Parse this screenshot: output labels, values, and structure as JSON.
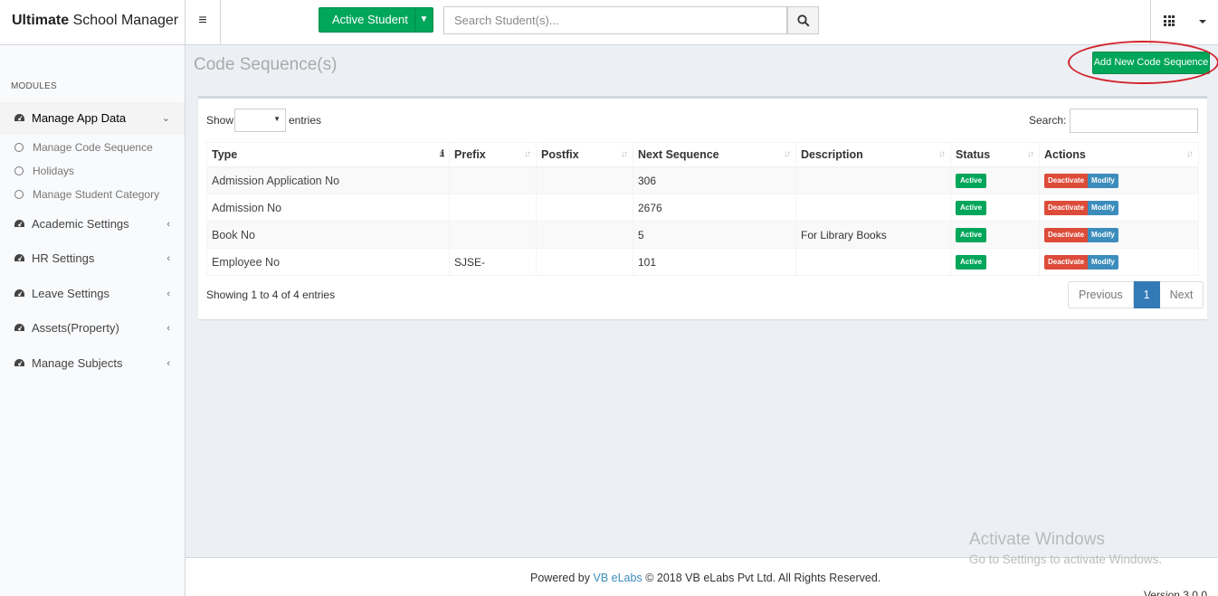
{
  "app": {
    "title_bold": "Ultimate",
    "title_rest": " School Manager"
  },
  "header": {
    "active_student_label": "Active Student",
    "search_placeholder": "Search Student(s)..."
  },
  "sidebar": {
    "modules_label": "MODULES",
    "items": [
      {
        "label": "Manage App Data",
        "expanded": true
      },
      {
        "label": "Academic Settings"
      },
      {
        "label": "HR Settings"
      },
      {
        "label": "Leave Settings"
      },
      {
        "label": "Assets(Property)"
      },
      {
        "label": "Manage Subjects"
      }
    ],
    "subitems": [
      {
        "label": "Manage Code Sequence"
      },
      {
        "label": "Holidays"
      },
      {
        "label": "Manage Student Category"
      }
    ]
  },
  "page": {
    "title": "Code Sequence(s)",
    "add_button": "Add New Code Sequence"
  },
  "table": {
    "show_label": "Show",
    "entries_label": "entries",
    "search_label": "Search:",
    "columns": [
      "Type",
      "Prefix",
      "Postfix",
      "Next Sequence",
      "Description",
      "Status",
      "Actions"
    ],
    "rows": [
      {
        "type": "Admission Application No",
        "prefix": "",
        "postfix": "",
        "next": "306",
        "description": "",
        "status": "Active"
      },
      {
        "type": "Admission No",
        "prefix": "",
        "postfix": "",
        "next": "2676",
        "description": "",
        "status": "Active"
      },
      {
        "type": "Book No",
        "prefix": "",
        "postfix": "",
        "next": "5",
        "description": "For Library Books",
        "status": "Active"
      },
      {
        "type": "Employee No",
        "prefix": "SJSE-",
        "postfix": "",
        "next": "101",
        "description": "",
        "status": "Active"
      }
    ],
    "deactivate_label": "Deactivate",
    "modify_label": "Modify",
    "showing_text": "Showing 1 to 4 of 4 entries",
    "pagination": {
      "previous": "Previous",
      "current": "1",
      "next": "Next"
    }
  },
  "footer": {
    "powered_by": "Powered by",
    "link": "VB eLabs",
    "copyright": "© 2018 VB eLabs Pvt Ltd. All Rights Reserved.",
    "version": "Version 3.0.0"
  },
  "watermark": {
    "line1": "Activate Windows",
    "line2": "Go to Settings to activate Windows."
  },
  "colors": {
    "green": "#00a65a",
    "red": "#dd4b39",
    "blue": "#3c8dbc",
    "annotation": "#d2232a"
  }
}
